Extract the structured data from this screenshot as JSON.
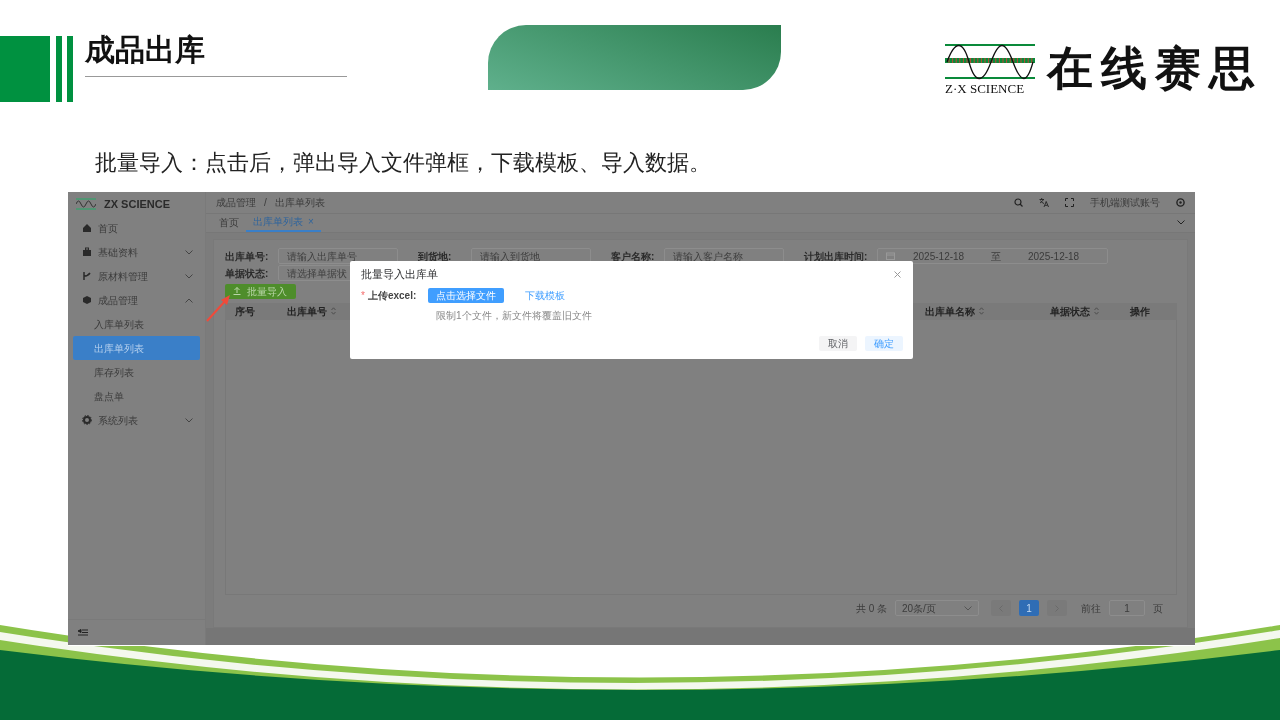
{
  "slide": {
    "title": "成品出库",
    "caption": "批量导入：点击后，弹出导入文件弹框，下载模板、导入数据。"
  },
  "logo": {
    "tagline": "Z·X SCIENCE",
    "name": "在线赛思"
  },
  "app": {
    "brand": "ZX SCIENCE",
    "sidebar": [
      {
        "label": "首页"
      },
      {
        "label": "基础资料",
        "expanded": false
      },
      {
        "label": "原材料管理",
        "expanded": false
      },
      {
        "label": "成品管理",
        "expanded": true,
        "children": [
          {
            "label": "入库单列表",
            "selected": false
          },
          {
            "label": "出库单列表",
            "selected": true
          },
          {
            "label": "库存列表",
            "selected": false
          },
          {
            "label": "盘点单",
            "selected": false
          }
        ]
      },
      {
        "label": "系统列表",
        "expanded": false
      }
    ],
    "breadcrumb": {
      "items": [
        "成品管理",
        "出库单列表"
      ],
      "separator": "/"
    },
    "user": "手机端测试账号",
    "tabs": [
      {
        "label": "首页",
        "selected": false
      },
      {
        "label": "出库单列表",
        "selected": true,
        "close": "×"
      }
    ],
    "filters": [
      {
        "kind": "text",
        "label": "出库单号:",
        "placeholder": "请输入出库单号"
      },
      {
        "kind": "text",
        "label": "到货地:",
        "placeholder": "请输入到货地"
      },
      {
        "kind": "text",
        "label": "客户名称:",
        "placeholder": "请输入客户名称"
      },
      {
        "kind": "daterange",
        "label": "计划出库时间:",
        "start": "2025-12-18",
        "separator": "至",
        "end": "2025-12-18"
      },
      {
        "kind": "select",
        "label": "单据状态:",
        "placeholder": "请选择单据状"
      }
    ],
    "import_button": "批量导入",
    "columns": [
      {
        "label": "序号",
        "sortable": false
      },
      {
        "label": "出库单号",
        "sortable": true
      },
      {
        "label": "出库单名称",
        "sortable": true
      },
      {
        "label": "单据状态",
        "sortable": true
      },
      {
        "label": "操作",
        "sortable": false
      }
    ],
    "pagination": {
      "total": "共 0 条",
      "page_size": "20条/页",
      "pages": [
        {
          "label": "1",
          "selected": true
        }
      ],
      "goto_label": "前往",
      "goto_value": "1",
      "goto_suffix": "页"
    },
    "modal": {
      "title": "批量导入出库单",
      "required_mark": "*",
      "field_label": "上传excel:",
      "upload_button": "点击选择文件",
      "template_link": "下载模板",
      "hint": "限制1个文件，新文件将覆盖旧文件",
      "buttons": [
        {
          "label": "取消",
          "kind": "default"
        },
        {
          "label": "确定",
          "kind": "primary"
        }
      ]
    }
  }
}
